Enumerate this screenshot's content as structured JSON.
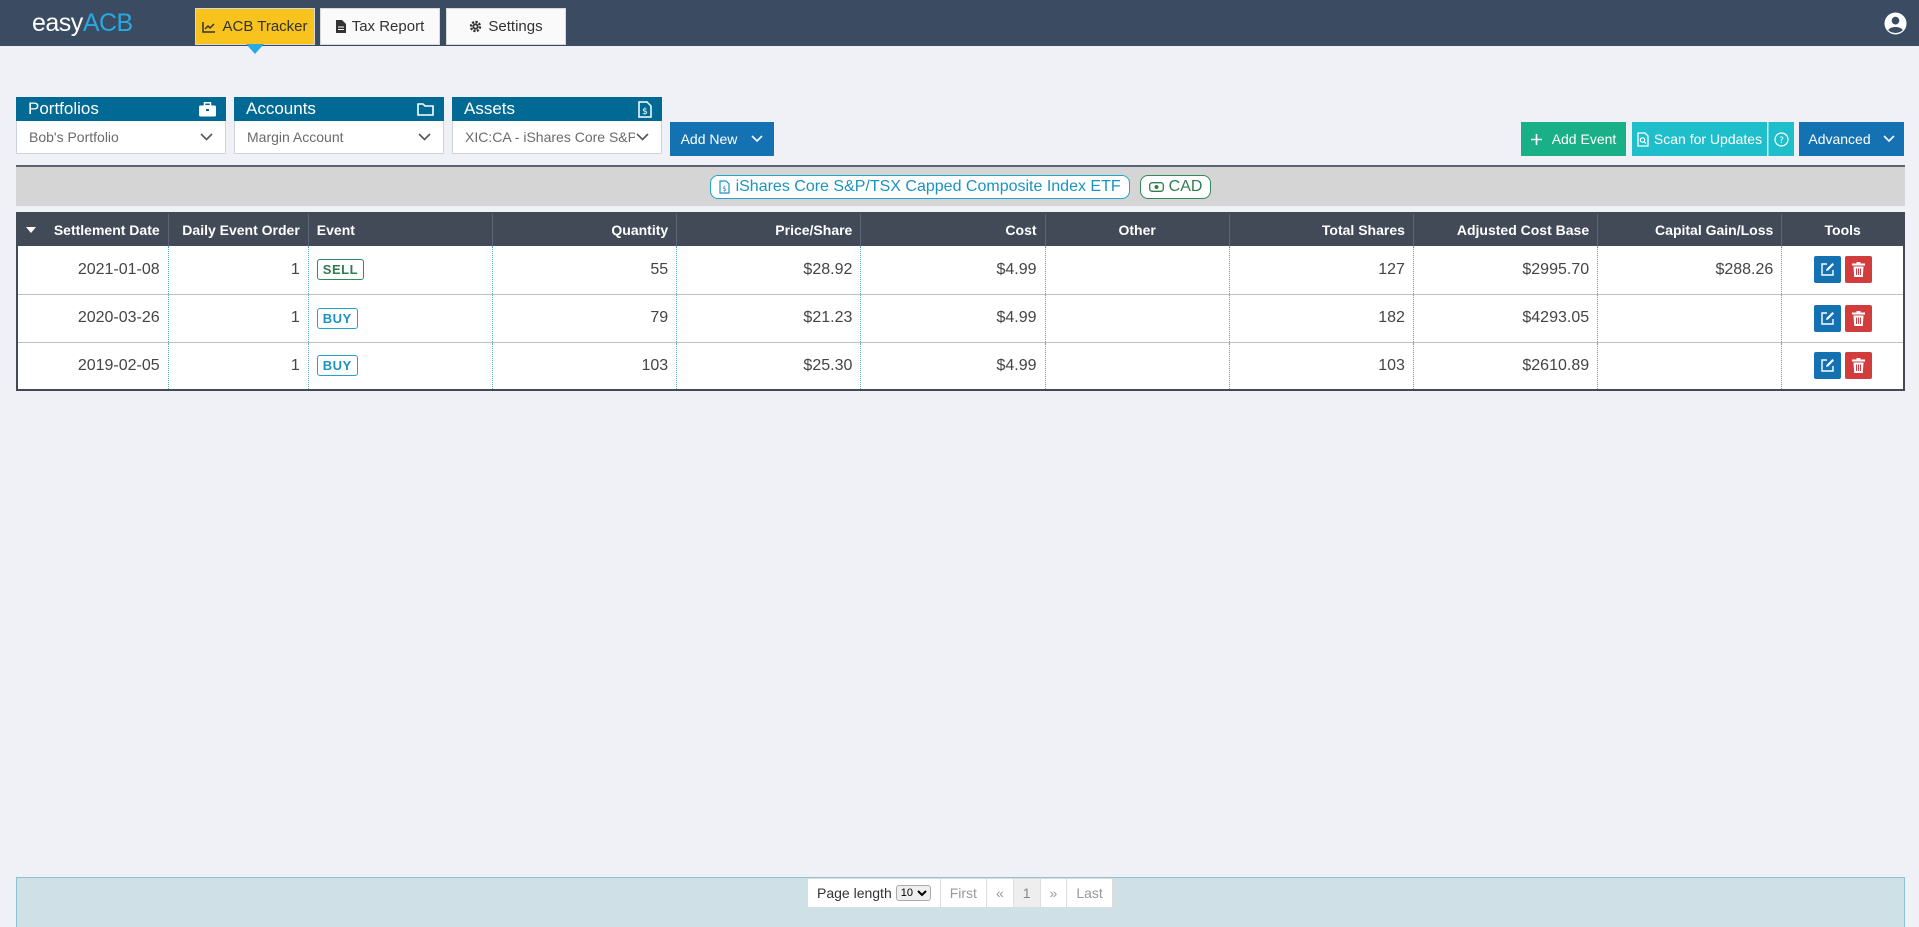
{
  "brand": {
    "part1": "easy",
    "part2": "ACB"
  },
  "nav": {
    "tabs": [
      {
        "label": "ACB Tracker",
        "icon": "chart-line-icon",
        "active": true
      },
      {
        "label": "Tax Report",
        "icon": "file-icon",
        "active": false
      },
      {
        "label": "Settings",
        "icon": "gear-icon",
        "active": false
      }
    ]
  },
  "selectors": {
    "portfolios": {
      "label": "Portfolios",
      "value": "Bob's Portfolio",
      "icon": "briefcase-icon"
    },
    "accounts": {
      "label": "Accounts",
      "value": "Margin Account",
      "icon": "folder-icon"
    },
    "assets": {
      "label": "Assets",
      "value": "XIC:CA - iShares Core S&P/TSX",
      "icon": "file-dollar-icon"
    }
  },
  "actions": {
    "add_new": "Add New",
    "add_event": "Add Event",
    "scan_updates": "Scan for Updates",
    "advanced": "Advanced"
  },
  "asset_info": {
    "name": "iShares Core S&P/TSX Capped Composite Index ETF",
    "currency": "CAD"
  },
  "table": {
    "headers": [
      "Settlement Date",
      "Daily Event Order",
      "Event",
      "Quantity",
      "Price/Share",
      "Cost",
      "Other",
      "Total Shares",
      "Adjusted Cost Base",
      "Capital Gain/Loss",
      "Tools"
    ],
    "rows": [
      {
        "date": "2021-01-08",
        "order": "1",
        "event": "SELL",
        "quantity": "55",
        "price": "$28.92",
        "cost": "$4.99",
        "other": "",
        "total": "127",
        "acb": "$2995.70",
        "gain": "$288.26"
      },
      {
        "date": "2020-03-26",
        "order": "1",
        "event": "BUY",
        "quantity": "79",
        "price": "$21.23",
        "cost": "$4.99",
        "other": "",
        "total": "182",
        "acb": "$4293.05",
        "gain": ""
      },
      {
        "date": "2019-02-05",
        "order": "1",
        "event": "BUY",
        "quantity": "103",
        "price": "$25.30",
        "cost": "$4.99",
        "other": "",
        "total": "103",
        "acb": "$2610.89",
        "gain": ""
      }
    ]
  },
  "pagination": {
    "page_length_label": "Page length",
    "page_length_value": "10",
    "first": "First",
    "prev": "«",
    "current": "1",
    "next": "»",
    "last": "Last"
  }
}
